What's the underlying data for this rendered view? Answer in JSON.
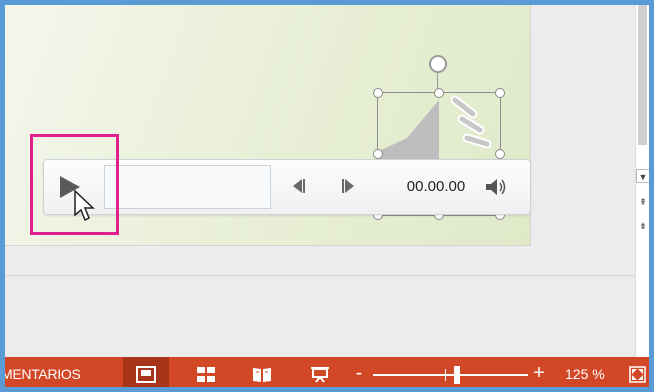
{
  "player": {
    "time": "00.00.00",
    "icons": {
      "play": "play-icon",
      "back": "skip-back-icon",
      "forward": "skip-forward-icon",
      "volume": "volume-icon"
    }
  },
  "statusbar": {
    "comments_label": "MENTARIOS",
    "zoom_label": "125 %",
    "zoom_minus": "-",
    "zoom_plus": "+",
    "views": [
      "normal-view-icon",
      "slide-sorter-icon",
      "reading-view-icon",
      "slideshow-icon"
    ],
    "fit_icon": "fit-to-window-icon"
  },
  "scrollbar": {
    "icons": [
      "scroll-down-icon",
      "previous-slide-icon",
      "next-slide-icon"
    ],
    "down_glyph": "▼",
    "prev_glyph": "⇞",
    "next_glyph": "⇟"
  },
  "colors": {
    "statusbar": "#d24726",
    "active_view": "#a83519",
    "highlight": "#e1208f",
    "window_border": "#5b9bd5",
    "slide_background": "#e8efd6"
  }
}
